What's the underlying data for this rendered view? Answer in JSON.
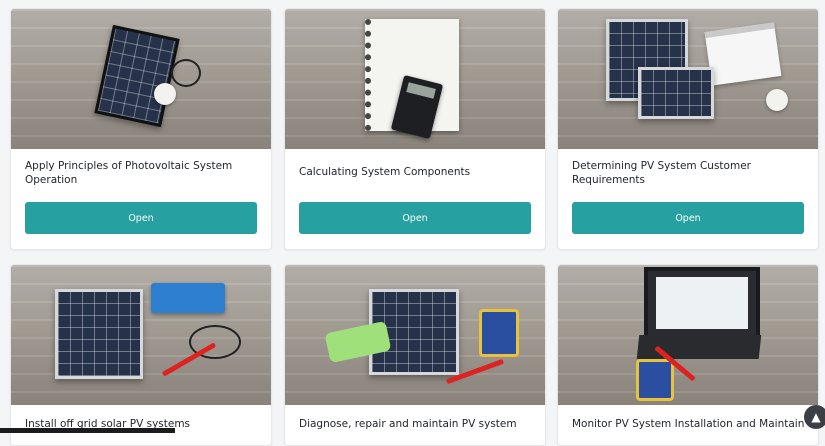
{
  "courses": [
    {
      "title": "Apply Principles of Photovoltaic System Operation",
      "button": "Open",
      "image": "solar-panel-with-bulb-image"
    },
    {
      "title": "Calculating System Components",
      "button": "Open",
      "image": "notepad-and-calculator-image"
    },
    {
      "title": "Determining PV System Customer Requirements",
      "button": "Open",
      "image": "solar-panels-clipboard-bulb-image"
    },
    {
      "title": "Install off grid solar PV systems",
      "image": "solar-panel-inverter-cables-image"
    },
    {
      "title": "Diagnose, repair and maintain PV system",
      "image": "solar-panel-multimeter-tools-image"
    },
    {
      "title": "Monitor PV System Installation and Maintain",
      "image": "laptop-multimeter-image"
    }
  ],
  "colors": {
    "accent": "#26a0a0",
    "background": "#f4f5f7",
    "card": "#ffffff"
  },
  "scroll_button_icon": "chevron-up-icon"
}
